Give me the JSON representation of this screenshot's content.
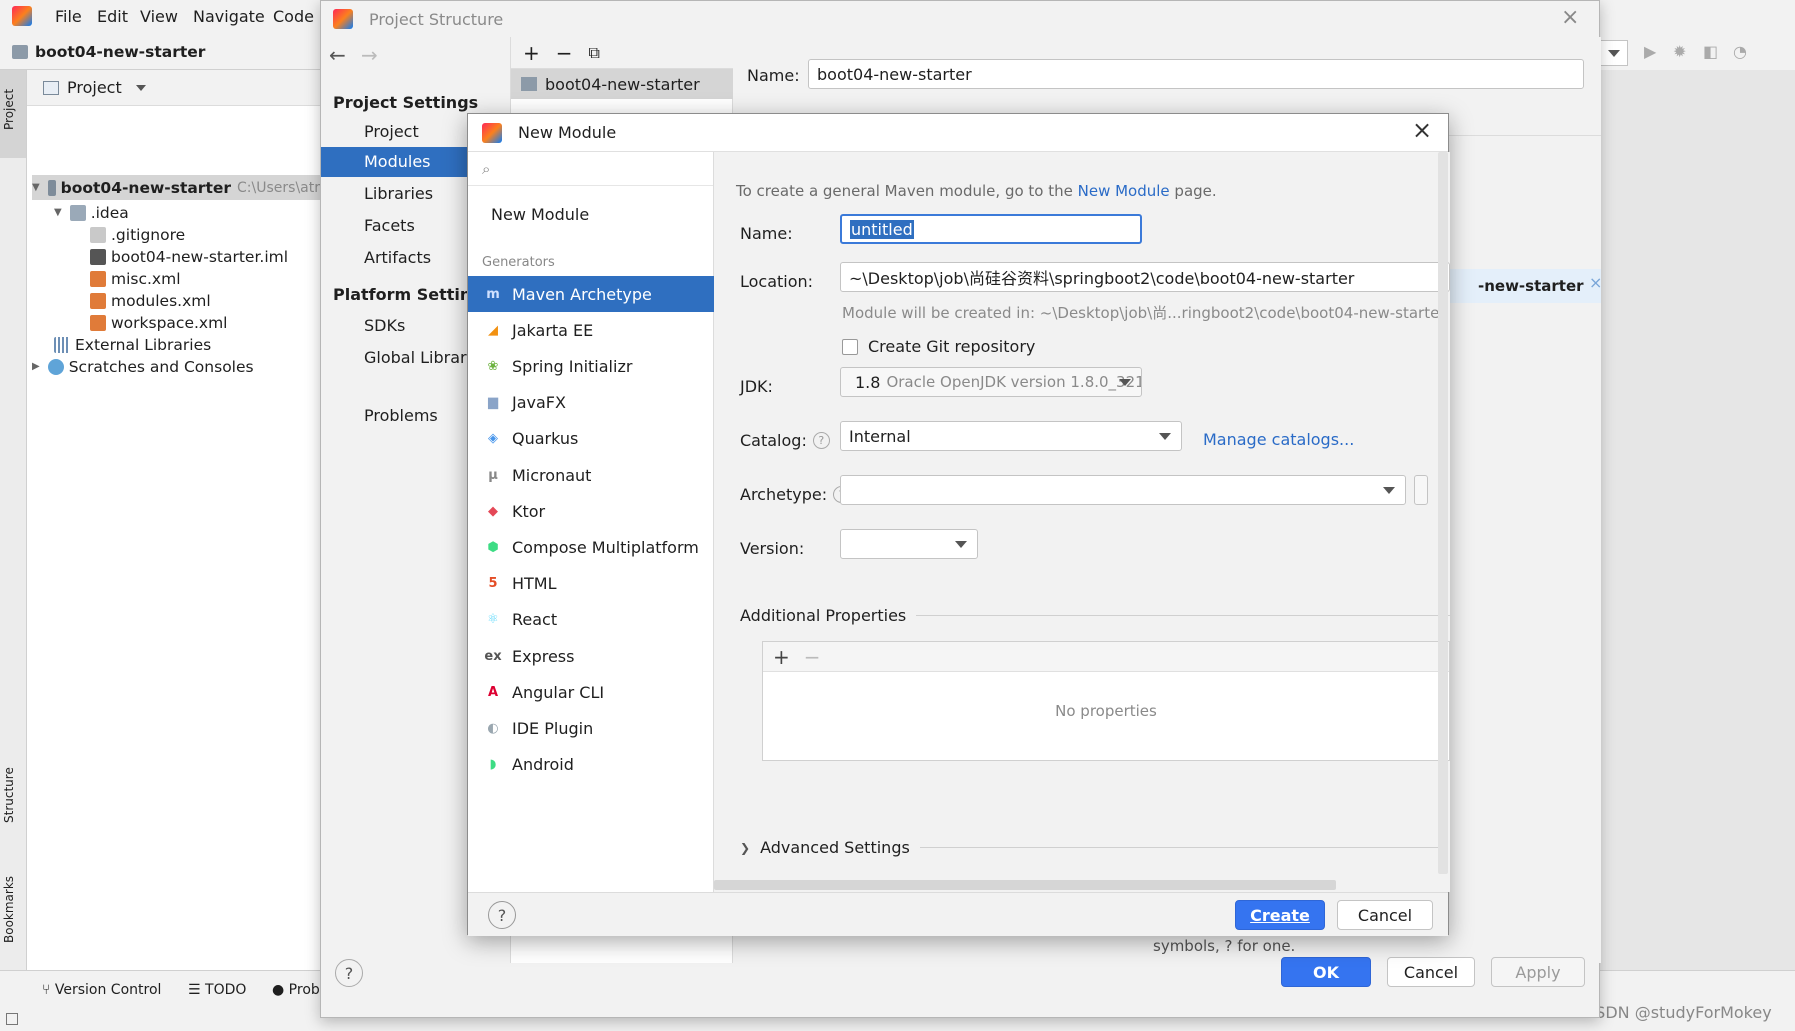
{
  "ide": {
    "menu": [
      "File",
      "Edit",
      "View",
      "Navigate",
      "Code"
    ],
    "breadcrumb": "boot04-new-starter",
    "project_panel_label": "Project",
    "side_tabs": {
      "project": "Project",
      "structure": "Structure",
      "bookmarks": "Bookmarks"
    },
    "tree": {
      "root_name": "boot04-new-starter",
      "root_path": "C:\\Users\\atr",
      "idea": ".idea",
      "files": [
        ".gitignore",
        "boot04-new-starter.iml",
        "misc.xml",
        "modules.xml",
        "workspace.xml"
      ],
      "external_libraries": "External Libraries",
      "scratches": "Scratches and Consoles"
    },
    "bottom_tabs": [
      "Version Control",
      "TODO",
      "Prob"
    ],
    "watermark": "CSDN @studyForMokey"
  },
  "project_structure": {
    "title": "Project Structure",
    "project_settings_header": "Project Settings",
    "project_settings_items": [
      "Project",
      "Modules",
      "Libraries",
      "Facets",
      "Artifacts"
    ],
    "platform_settings_header": "Platform Settings",
    "platform_settings_items": [
      "SDKs",
      "Global Librarie"
    ],
    "problems": "Problems",
    "module_item": "boot04-new-starter",
    "name_label": "Name:",
    "name_value": "boot04-new-starter",
    "right_tab_text": "-new-starter",
    "hint_text": "symbols, ? for one.",
    "ok": "OK",
    "cancel": "Cancel",
    "apply": "Apply"
  },
  "new_module": {
    "title": "New Module",
    "search_placeholder": "",
    "new_module_item": "New Module",
    "generators_header": "Generators",
    "generators": [
      {
        "label": "Maven Archetype",
        "icon": "m",
        "color": "#7aa0e8"
      },
      {
        "label": "Jakarta EE",
        "icon": "◢",
        "color": "#f29111"
      },
      {
        "label": "Spring Initializr",
        "icon": "❀",
        "color": "#6db33f"
      },
      {
        "label": "JavaFX",
        "icon": "▆",
        "color": "#8aa4c8"
      },
      {
        "label": "Quarkus",
        "icon": "◈",
        "color": "#4695eb"
      },
      {
        "label": "Micronaut",
        "icon": "μ",
        "color": "#888888"
      },
      {
        "label": "Ktor",
        "icon": "◆",
        "color": "#e44857"
      },
      {
        "label": "Compose Multiplatform",
        "icon": "⬢",
        "color": "#3ddc84"
      },
      {
        "label": "HTML",
        "icon": "5",
        "color": "#e44d26"
      },
      {
        "label": "React",
        "icon": "⚛",
        "color": "#61dafb"
      },
      {
        "label": "Express",
        "icon": "ex",
        "color": "#555555"
      },
      {
        "label": "Angular CLI",
        "icon": "A",
        "color": "#dd0031"
      },
      {
        "label": "IDE Plugin",
        "icon": "◐",
        "color": "#9aa7b0"
      },
      {
        "label": "Android",
        "icon": "◗",
        "color": "#3ddc84"
      }
    ],
    "info_prefix": "To create a general Maven module, go to the ",
    "info_link": "New Module",
    "info_suffix": " page.",
    "name_label": "Name:",
    "name_value": "untitled",
    "location_label": "Location:",
    "location_value": "~\\Desktop\\job\\尚硅谷资料\\springboot2\\code\\boot04-new-starter",
    "created_in": "Module will be created in: ~\\Desktop\\job\\尚...ringboot2\\code\\boot04-new-starte",
    "git_label": "Create Git repository",
    "git_checked": false,
    "jdk_label": "JDK:",
    "jdk_version": "1.8",
    "jdk_desc": "Oracle OpenJDK version 1.8.0_321",
    "catalog_label": "Catalog:",
    "catalog_value": "Internal",
    "manage_catalogs": "Manage catalogs...",
    "archetype_label": "Archetype:",
    "archetype_value": "",
    "version_label": "Version:",
    "version_value": "",
    "additional_properties": "Additional Properties",
    "no_properties": "No properties",
    "advanced_settings": "Advanced Settings",
    "create": "Create",
    "cancel": "Cancel"
  }
}
